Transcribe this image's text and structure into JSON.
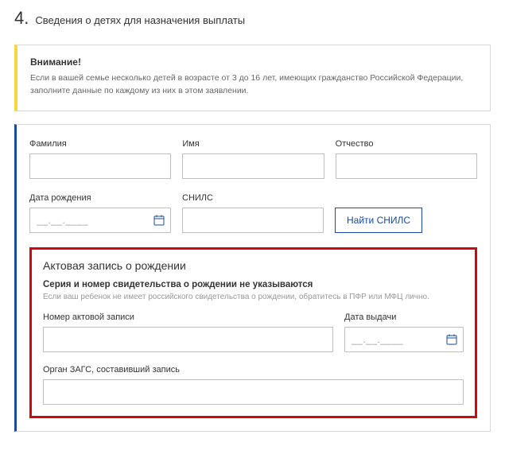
{
  "section": {
    "number": "4.",
    "title": "Сведения о детях для назначения выплаты"
  },
  "warning": {
    "heading": "Внимание!",
    "body": "Если в вашей семье несколько детей в возрасте от 3 до 16 лет, имеющих гражданство Российской Федерации, заполните данные по каждому из них в этом заявлении."
  },
  "labels": {
    "surname": "Фамилия",
    "name": "Имя",
    "patronymic": "Отчество",
    "dob": "Дата рождения",
    "snils": "СНИЛС",
    "find_snils": "Найти СНИЛС"
  },
  "placeholders": {
    "date": "__.__.____"
  },
  "birthRecord": {
    "title": "Актовая запись о рождении",
    "sub": "Серия и номер свидетельства о рождении не указываются",
    "note": "Если ваш ребенок не имеет российского свидетельства о рождении, обратитесь в ПФР или МФЦ лично.",
    "record_number": "Номер актовой записи",
    "issue_date": "Дата выдачи",
    "zags": "Орган ЗАГС, составивший запись"
  }
}
